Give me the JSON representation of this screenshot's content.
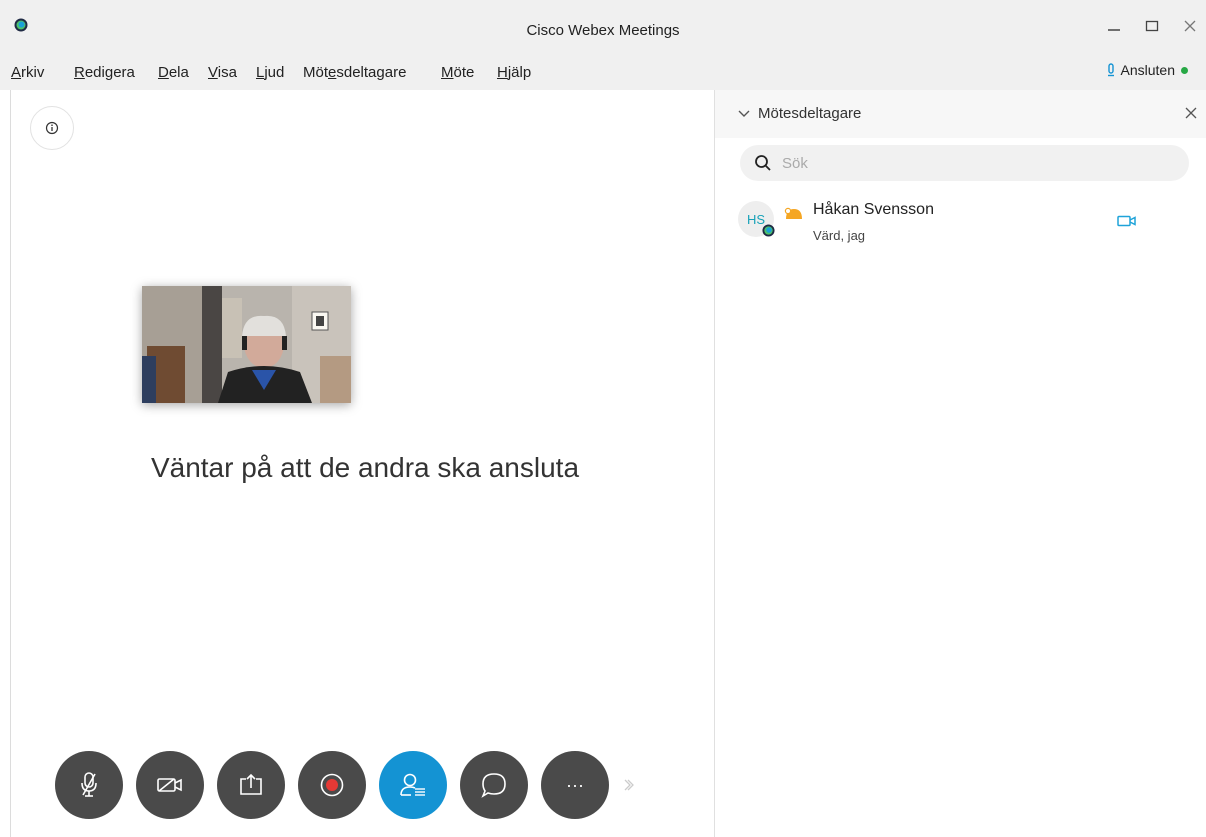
{
  "window": {
    "title": "Cisco Webex Meetings"
  },
  "menu": {
    "items": [
      {
        "pre": "",
        "ul": "A",
        "post": "rkiv"
      },
      {
        "pre": "",
        "ul": "R",
        "post": "edigera"
      },
      {
        "pre": "",
        "ul": "D",
        "post": "ela"
      },
      {
        "pre": "",
        "ul": "V",
        "post": "isa"
      },
      {
        "pre": "",
        "ul": "L",
        "post": "jud"
      },
      {
        "pre": "Möt",
        "ul": "e",
        "post": "sdeltagare"
      },
      {
        "pre": "",
        "ul": "M",
        "post": "öte"
      },
      {
        "pre": "",
        "ul": "H",
        "post": "jälp"
      }
    ]
  },
  "status": {
    "label": "Ansluten",
    "color": "#27a845"
  },
  "main": {
    "waiting_message": "Väntar på att de andra ska ansluta"
  },
  "controls": {
    "buttons": [
      "microphone-muted-icon",
      "video-off-icon",
      "share-icon",
      "record-icon",
      "participants-icon",
      "chat-icon",
      "more-icon"
    ],
    "active": "participants-icon",
    "accent": "#1493d3",
    "more_glyph": "···"
  },
  "panel": {
    "title": "Mötesdeltagare",
    "search_placeholder": "Sök",
    "participants": [
      {
        "initials": "HS",
        "name": "Håkan Svensson",
        "role": "Värd, jag"
      }
    ]
  }
}
